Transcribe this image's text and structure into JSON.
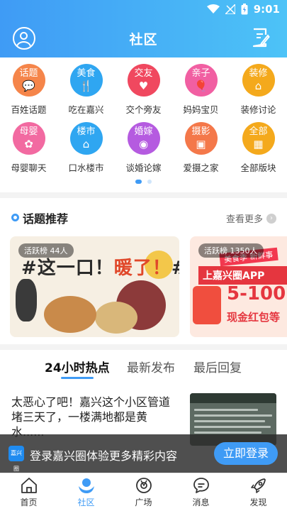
{
  "status_bar": {
    "time": "9:01"
  },
  "header": {
    "title": "社区"
  },
  "categories": [
    {
      "icon_text": "话题",
      "glyph": "💬",
      "label": "百姓话题",
      "color": "#f5854a"
    },
    {
      "icon_text": "美食",
      "glyph": "🍴",
      "label": "吃在嘉兴",
      "color": "#2fa6f1"
    },
    {
      "icon_text": "交友",
      "glyph": "♥",
      "label": "交个旁友",
      "color": "#f0485f"
    },
    {
      "icon_text": "亲子",
      "glyph": "🎈",
      "label": "妈妈宝贝",
      "color": "#f15fa2"
    },
    {
      "icon_text": "装修",
      "glyph": "⌂",
      "label": "装修讨论",
      "color": "#f4a91c"
    },
    {
      "icon_text": "母婴",
      "glyph": "✿",
      "label": "母婴聊天",
      "color": "#f26aa1"
    },
    {
      "icon_text": "楼市",
      "glyph": "⌂",
      "label": "口水楼市",
      "color": "#2fa6f1"
    },
    {
      "icon_text": "婚嫁",
      "glyph": "◉",
      "label": "谈婚论嫁",
      "color": "#b55be0"
    },
    {
      "icon_text": "摄影",
      "glyph": "▣",
      "label": "爱摄之家",
      "color": "#f4784a"
    },
    {
      "icon_text": "全部",
      "glyph": "▦",
      "label": "全部版块",
      "color": "#f4a91c"
    }
  ],
  "topics": {
    "title": "话题推荐",
    "more": "查看更多",
    "cards": [
      {
        "badge": "活跃榜 44人",
        "headline_a": "#这一口！",
        "headline_b": "暖了！",
        "headline_c": "#"
      },
      {
        "badge": "活跃榜 1350人",
        "top": "美食季 新鲜事",
        "line1": "上嘉兴圈APP",
        "big": "5-100",
        "line3": "现金红包等"
      }
    ]
  },
  "tabs": [
    {
      "label": "24小时热点"
    },
    {
      "label": "最新发布"
    },
    {
      "label": "最后回复"
    }
  ],
  "post": {
    "title": "太恶心了吧！嘉兴这个小区管道堵三天了，一楼满地都是黄水......"
  },
  "login_bar": {
    "logo": "嘉兴圈",
    "text": "登录嘉兴圈体验更多精彩内容",
    "button": "立即登录"
  },
  "bottom_nav": [
    {
      "label": "首页"
    },
    {
      "label": "社区"
    },
    {
      "label": "广场"
    },
    {
      "label": "消息"
    },
    {
      "label": "发现"
    }
  ],
  "colors": {
    "accent": "#3f9bf5",
    "header_gradient_start": "#3f9bf5",
    "header_gradient_end": "#4dc3f7"
  }
}
